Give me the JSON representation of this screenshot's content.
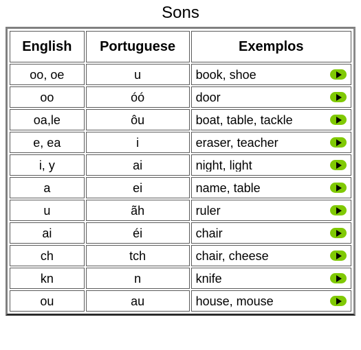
{
  "page": {
    "title": "Sons"
  },
  "table": {
    "columns": [
      {
        "key": "english",
        "label": "English"
      },
      {
        "key": "portuguese",
        "label": "Portuguese"
      },
      {
        "key": "exemplos",
        "label": "Exemplos"
      }
    ],
    "play_icon": "play-icon",
    "accent_green": "#80c904",
    "border_gray": "#808080",
    "rows": [
      {
        "english": "oo, oe",
        "portuguese": "u",
        "exemplos": "book, shoe",
        "play_label": "▶"
      },
      {
        "english": "oo",
        "portuguese": "óó",
        "exemplos": "door",
        "play_label": "▶"
      },
      {
        "english": "oa,le",
        "portuguese": "ôu",
        "exemplos": "boat, table, tackle",
        "play_label": "▶"
      },
      {
        "english": "e, ea",
        "portuguese": "i",
        "exemplos": "eraser, teacher",
        "play_label": "▶"
      },
      {
        "english": "i, y",
        "portuguese": "ai",
        "exemplos": "night, light",
        "play_label": "▶"
      },
      {
        "english": "a",
        "portuguese": "ei",
        "exemplos": "name, table",
        "play_label": "▶"
      },
      {
        "english": "u",
        "portuguese": "ãh",
        "exemplos": "ruler",
        "play_label": "▶"
      },
      {
        "english": "ai",
        "portuguese": "éi",
        "exemplos": "chair",
        "play_label": "▶"
      },
      {
        "english": "ch",
        "portuguese": "tch",
        "exemplos": "chair, cheese",
        "play_label": "▶"
      },
      {
        "english": "kn",
        "portuguese": "n",
        "exemplos": "knife",
        "play_label": "▶"
      },
      {
        "english": "ou",
        "portuguese": "au",
        "exemplos": "house, mouse",
        "play_label": "▶"
      }
    ]
  }
}
